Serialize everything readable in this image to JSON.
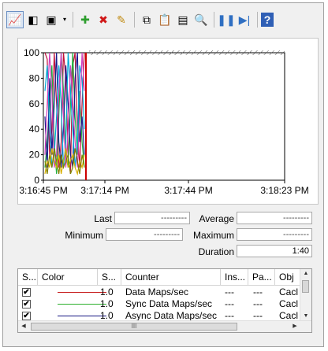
{
  "toolbar": {
    "buttons": [
      {
        "name": "view-graph-icon",
        "glyph": "📈",
        "pressed": true
      },
      {
        "name": "freeze-display-icon",
        "glyph": "◧",
        "pressed": false
      },
      {
        "name": "change-graph-type-icon",
        "glyph": "▣",
        "pressed": false
      },
      {
        "name": "dropdown-arrow-icon",
        "glyph": "▾",
        "pressed": false,
        "narrow": true
      },
      {
        "name": "separator"
      },
      {
        "name": "add-counter-icon",
        "glyph": "✚",
        "color": "#2e9e2e",
        "pressed": false
      },
      {
        "name": "delete-counter-icon",
        "glyph": "✖",
        "color": "#d01818",
        "pressed": false
      },
      {
        "name": "highlight-pencil-icon",
        "glyph": "✎",
        "color": "#c08a10",
        "pressed": false
      },
      {
        "name": "separator"
      },
      {
        "name": "copy-properties-icon",
        "glyph": "⧉",
        "pressed": false
      },
      {
        "name": "paste-counter-list-icon",
        "glyph": "📋",
        "pressed": false
      },
      {
        "name": "properties-icon",
        "glyph": "▤",
        "pressed": false
      },
      {
        "name": "zoom-icon",
        "glyph": "🔍",
        "pressed": false
      },
      {
        "name": "separator"
      },
      {
        "name": "pause-icon",
        "glyph": "❚❚",
        "color": "#2f6fc2",
        "pressed": false
      },
      {
        "name": "update-data-icon",
        "glyph": "▶|",
        "color": "#2f6fc2",
        "pressed": false
      },
      {
        "name": "separator"
      },
      {
        "name": "help-icon",
        "glyph": "?",
        "color": "#ffffff",
        "bg": "#2f5fb5",
        "pressed": false
      }
    ]
  },
  "chart_data": {
    "type": "line",
    "ylim": [
      0,
      100
    ],
    "yticks": [
      0,
      20,
      40,
      60,
      80,
      100
    ],
    "xticks": [
      "3:16:45 PM",
      "3:17:14 PM",
      "3:17:44 PM",
      "3:18:23 PM"
    ],
    "grid": false,
    "series": [
      {
        "color": "#c0143c",
        "values": [
          100,
          95,
          20,
          40,
          100,
          60,
          10,
          30,
          100,
          80,
          20,
          5,
          90,
          100,
          40,
          10,
          60,
          100
        ]
      },
      {
        "color": "#20b040",
        "values": [
          10,
          30,
          60,
          90,
          30,
          5,
          50,
          100,
          70,
          20,
          10,
          60,
          100,
          50,
          20,
          70,
          30,
          10
        ]
      },
      {
        "color": "#1a1a8c",
        "values": [
          50,
          10,
          80,
          20,
          60,
          100,
          30,
          10,
          40,
          90,
          60,
          20,
          10,
          80,
          100,
          30,
          50,
          20
        ]
      },
      {
        "color": "#00a8d8",
        "values": [
          70,
          90,
          40,
          10,
          20,
          50,
          90,
          60,
          10,
          30,
          100,
          70,
          40,
          10,
          30,
          90,
          80,
          40
        ]
      },
      {
        "color": "#d040c0",
        "values": [
          20,
          60,
          100,
          70,
          10,
          20,
          70,
          100,
          50,
          10,
          40,
          90,
          60,
          30,
          10,
          50,
          100,
          70
        ]
      },
      {
        "color": "#d8b000",
        "values": [
          5,
          15,
          10,
          25,
          15,
          10,
          20,
          5,
          15,
          25,
          10,
          15,
          20,
          10,
          5,
          15,
          10,
          20
        ]
      },
      {
        "color": "#808000",
        "values": [
          15,
          5,
          20,
          10,
          25,
          15,
          5,
          20,
          10,
          15,
          20,
          5,
          10,
          25,
          15,
          5,
          20,
          10
        ]
      }
    ]
  },
  "stats": {
    "last_label": "Last",
    "last_value": "---------",
    "average_label": "Average",
    "average_value": "---------",
    "minimum_label": "Minimum",
    "minimum_value": "---------",
    "maximum_label": "Maximum",
    "maximum_value": "---------",
    "duration_label": "Duration",
    "duration_value": "1:40"
  },
  "counters": {
    "columns": [
      "S...",
      "Color",
      "S...",
      "Counter",
      "Ins...",
      "Pa...",
      "Obj"
    ],
    "rows": [
      {
        "checked": "✔",
        "color": "#c81e1e",
        "scale": "1.0",
        "counter": "Data Maps/sec",
        "instance": "---",
        "parent": "---",
        "object": "Cacl"
      },
      {
        "checked": "✔",
        "color": "#2cb02c",
        "scale": "1.0",
        "counter": "Sync Data Maps/sec",
        "instance": "---",
        "parent": "---",
        "object": "Cacl"
      },
      {
        "checked": "✔",
        "color": "#141480",
        "scale": "1.0",
        "counter": "Async Data Maps/sec",
        "instance": "---",
        "parent": "---",
        "object": "Cacl"
      }
    ],
    "hscroll_grip": "III"
  }
}
